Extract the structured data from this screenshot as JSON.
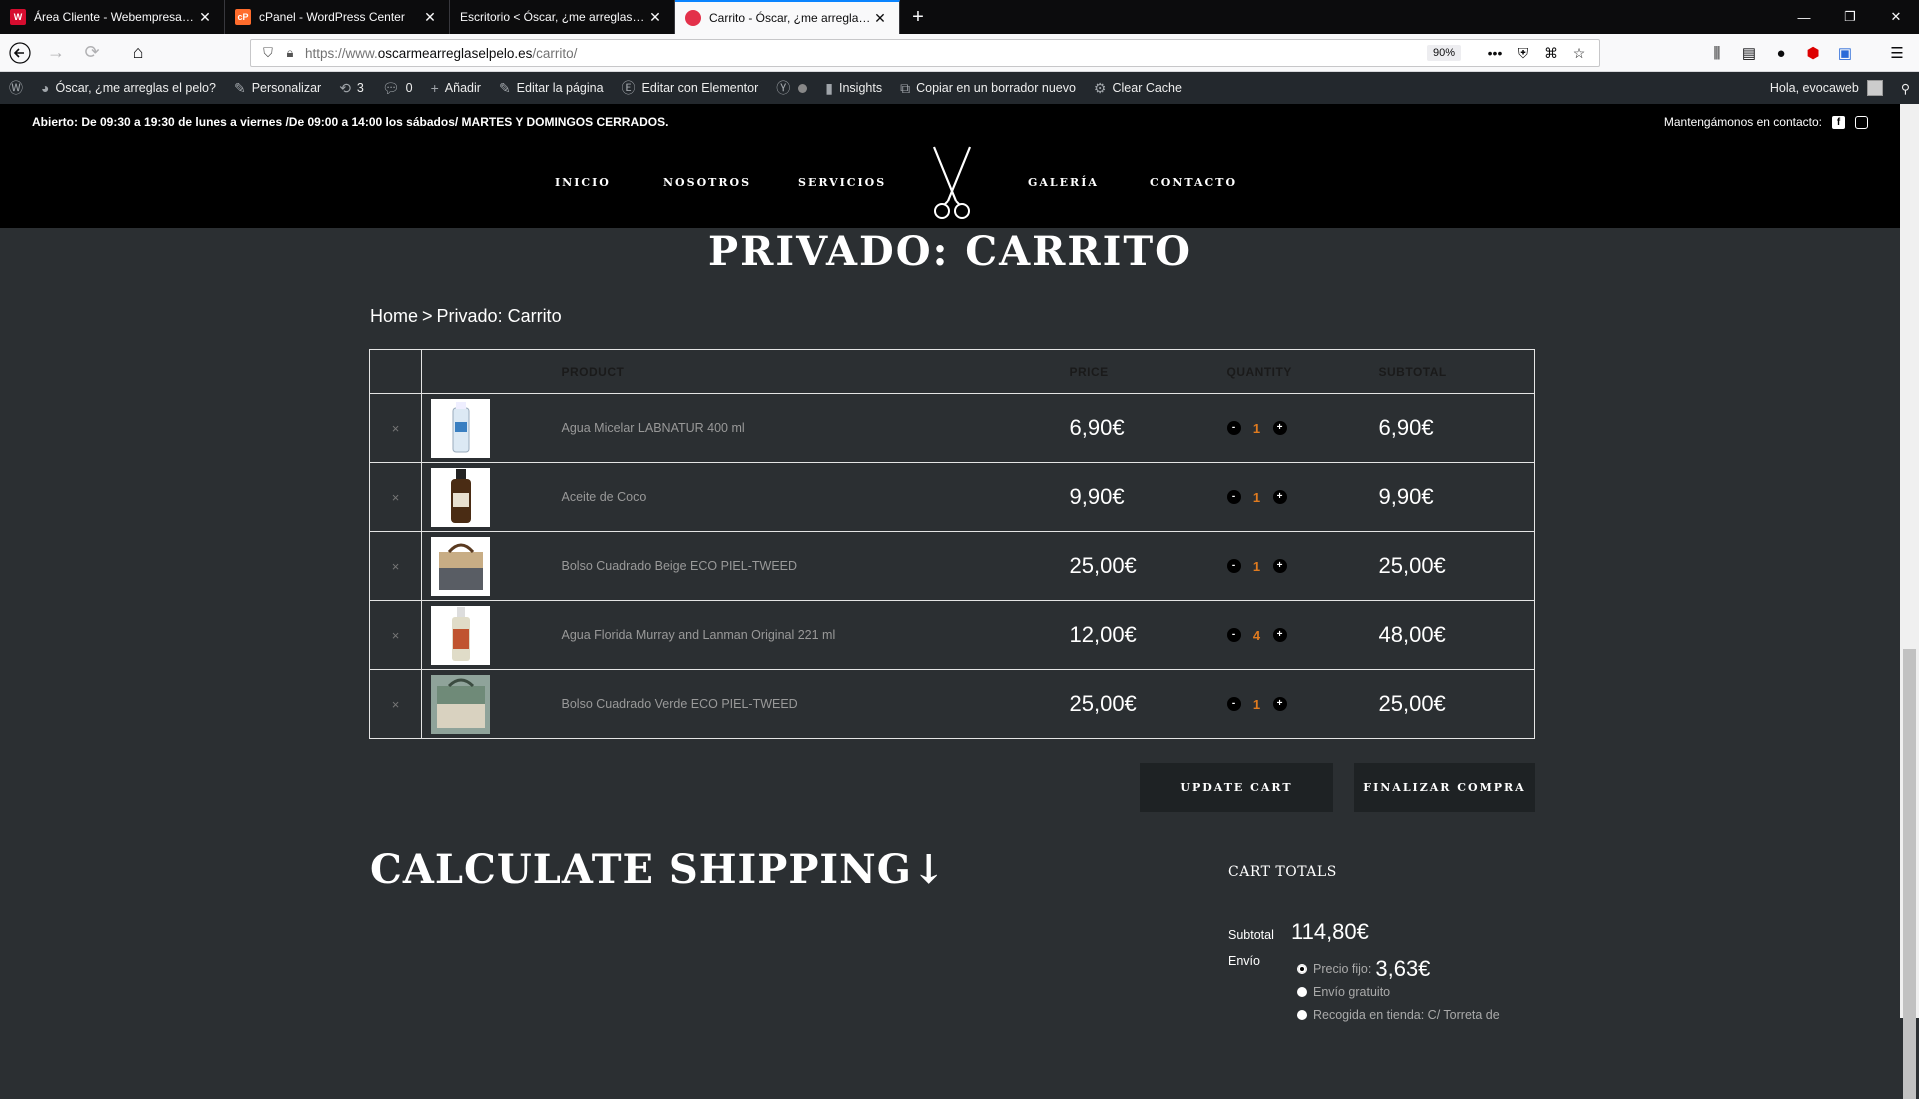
{
  "browser": {
    "tabs": [
      {
        "title": "Área Cliente - Webempresa Eur",
        "favicon_color": "#d60d2f",
        "favicon_text": "W"
      },
      {
        "title": "cPanel - WordPress Center",
        "favicon_color": "#ff6c2c",
        "favicon_text": "cP"
      },
      {
        "title": "Escritorio < Óscar, ¿me arreglas el p",
        "favicon_color": "#0c0c0d",
        "favicon_text": ""
      },
      {
        "title": "Carrito - Óscar, ¿me arreglas el",
        "favicon_color": "#e3314a",
        "favicon_text": ""
      }
    ],
    "new_tab": "+",
    "url_prefix": "https://www.",
    "url_domain": "oscarmearreglaselpelo.es",
    "url_path": "/carrito/",
    "zoom": "90%"
  },
  "adminbar": {
    "site_name": "Óscar, ¿me arreglas el pelo?",
    "customize": "Personalizar",
    "updates": "3",
    "comments": "0",
    "add_new": "Añadir",
    "edit_page": "Editar la página",
    "edit_elementor": "Editar con Elementor",
    "insights": "Insights",
    "copy_draft": "Copiar en un borrador nuevo",
    "clear_cache": "Clear Cache",
    "greeting": "Hola, evocaweb"
  },
  "site": {
    "hours": "Abierto: De 09:30 a 19:30 de lunes a viernes  /De 09:00 a 14:00 los sábados/ MARTES Y DOMINGOS CERRADOS.",
    "contact": "Mantengámonos en contacto:",
    "nav": [
      "INICIO",
      "NOSOTROS",
      "SERVICIOS",
      "GALERÍA",
      "CONTACTO"
    ]
  },
  "page": {
    "title": "PRIVADO: CARRITO",
    "breadcrumb_home": "Home",
    "breadcrumb_sep": ">",
    "breadcrumb_current": "Privado: Carrito"
  },
  "cart": {
    "headers": {
      "product": "PRODUCT",
      "price": "PRICE",
      "quantity": "QUANTITY",
      "subtotal": "SUBTOTAL"
    },
    "remove_symbol": "×",
    "minus_symbol": "-",
    "plus_symbol": "+",
    "items": [
      {
        "name": "Agua Micelar LABNATUR 400 ml",
        "price": "6,90€",
        "qty": "1",
        "subtotal": "6,90€",
        "thumb_color": "#e8f0f8"
      },
      {
        "name": "Aceite de Coco",
        "price": "9,90€",
        "qty": "1",
        "subtotal": "9,90€",
        "thumb_color": "#3a2a1c"
      },
      {
        "name": "Bolso Cuadrado Beige ECO PIEL-TWEED",
        "price": "25,00€",
        "qty": "1",
        "subtotal": "25,00€",
        "thumb_color": "#b49a78"
      },
      {
        "name": "Agua Florida Murray and Lanman Original 221 ml",
        "price": "12,00€",
        "qty": "4",
        "subtotal": "48,00€",
        "thumb_color": "#c98a5a"
      },
      {
        "name": "Bolso Cuadrado Verde ECO PIEL-TWEED",
        "price": "25,00€",
        "qty": "1",
        "subtotal": "25,00€",
        "thumb_color": "#6f8a78"
      }
    ],
    "update_button": "UPDATE CART",
    "checkout_button": "FINALIZAR COMPRA"
  },
  "shipping": {
    "title": "CALCULATE SHIPPING↓"
  },
  "totals": {
    "title": "CART TOTALS",
    "subtotal_label": "Subtotal",
    "subtotal_value": "114,80€",
    "shipping_label": "Envío",
    "option_fixed": "Precio fijo:",
    "option_fixed_value": "3,63€",
    "option_free": "Envío gratuito",
    "option_pickup": "Recogida en tienda: C/ Torreta de"
  }
}
